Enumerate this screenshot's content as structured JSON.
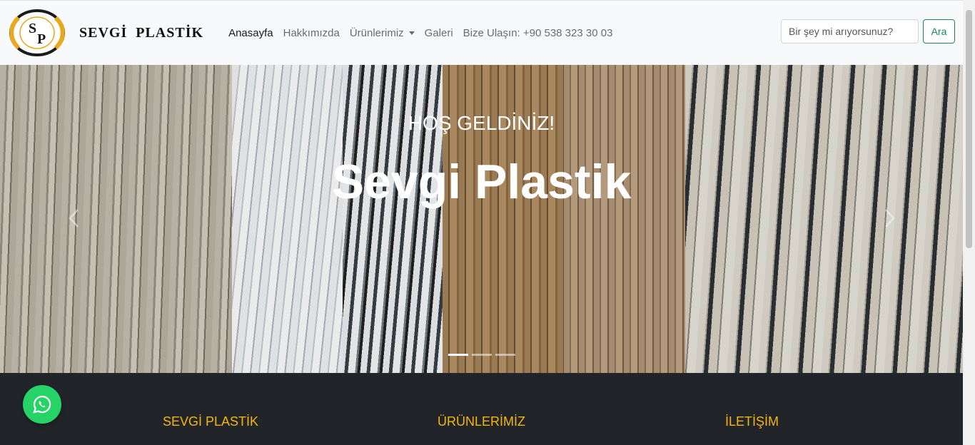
{
  "brand": {
    "name": "SEVGİ  PLASTİK",
    "logo_letters": [
      "S",
      "P"
    ],
    "colors": {
      "gold": "#e8a91e",
      "dark": "#1a1a1a"
    }
  },
  "nav": {
    "items": [
      {
        "label": "Anasayfa",
        "active": true
      },
      {
        "label": "Hakkımızda"
      },
      {
        "label": "Ürünlerimiz",
        "dropdown": true
      },
      {
        "label": "Galeri"
      },
      {
        "label": "Bize Ulaşın: +90 538 323 30 03"
      }
    ]
  },
  "search": {
    "placeholder": "Bir şey mi arıyorsunuz?",
    "button": "Ara",
    "accent": "#198754"
  },
  "hero": {
    "subtitle": "HOŞ GELDİNİZ!",
    "title": "Sevgi Plastik",
    "indicator_count": 3,
    "active_indicator": 0
  },
  "footer": {
    "headings": [
      "SEVGİ PLASTİK",
      "ÜRÜNLERİMİZ",
      "İLETİŞİM"
    ],
    "heading_color": "#f5b50f",
    "bg": "#212529"
  },
  "whatsapp": {
    "icon": "whatsapp-icon",
    "color": "#25d366"
  }
}
